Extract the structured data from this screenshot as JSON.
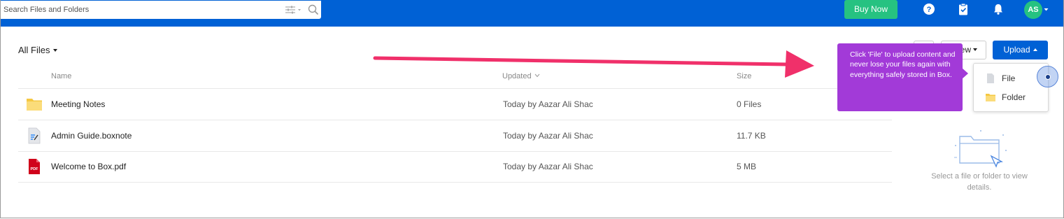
{
  "topbar": {
    "search_placeholder": "Search Files and Folders",
    "buy_now_label": "Buy Now",
    "avatar_initials": "AS",
    "brand_color": "#0061d5",
    "accent_green": "#26c281"
  },
  "toolbar": {
    "breadcrumb_label": "All Files",
    "new_label": "ew",
    "upload_label": "Upload"
  },
  "table": {
    "columns": {
      "name": "Name",
      "updated": "Updated",
      "size": "Size"
    },
    "rows": [
      {
        "name": "Meeting Notes",
        "updated": "Today by Aazar Ali Shac",
        "size": "0 Files",
        "icon": "folder-icon"
      },
      {
        "name": "Admin Guide.boxnote",
        "updated": "Today by Aazar Ali Shac",
        "size": "11.7 KB",
        "icon": "boxnote-icon"
      },
      {
        "name": "Welcome to Box.pdf",
        "updated": "Today by Aazar Ali Shac",
        "size": "5 MB",
        "icon": "pdf-icon"
      }
    ]
  },
  "upload_menu": {
    "file_label": "File",
    "folder_label": "Folder"
  },
  "tooltip": {
    "text": "Click 'File' to upload content and never lose your files again with everything safely stored in Box.",
    "color": "#a23ad8"
  },
  "details_panel": {
    "empty_text": "Select a file or folder to view details."
  },
  "annotation_arrow_color": "#f0306a"
}
